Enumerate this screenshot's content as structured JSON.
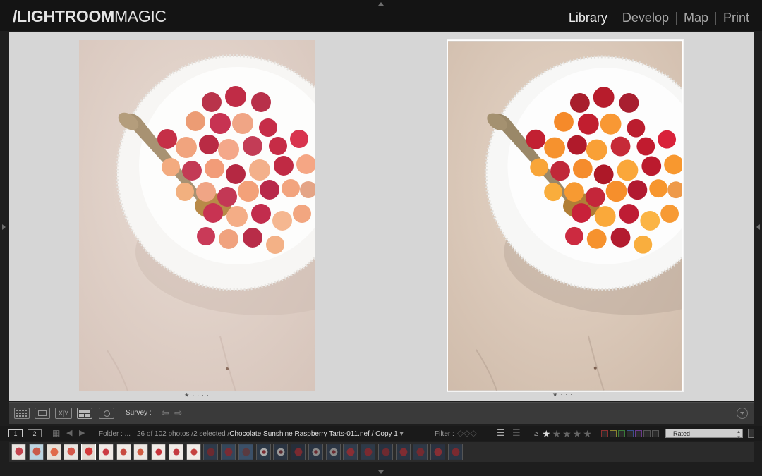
{
  "app": {
    "logo_bold": "/LIGHTROOM",
    "logo_light": "MAGIC"
  },
  "modules": [
    {
      "label": "Library",
      "active": true
    },
    {
      "label": "Develop",
      "active": false
    },
    {
      "label": "Map",
      "active": false
    },
    {
      "label": "Print",
      "active": false
    }
  ],
  "survey": {
    "left_rating_dots": "★ · · · ·",
    "right_rating_dots": "★ · · · ·"
  },
  "toolbar": {
    "survey_label": "Survey :",
    "view_icons": [
      "grid-view-icon",
      "loupe-view-icon",
      "compare-view-icon",
      "survey-view-icon",
      "people-view-icon"
    ],
    "compare_label": "X|Y"
  },
  "filmstrip_header": {
    "display1": "1",
    "display2": "2",
    "folder_label": "Folder : ...",
    "count_text": "26 of 102 photos /2 selected /",
    "filename": "Chocolate Sunshine Raspberry Tarts-011.nef / Copy 1",
    "filter_label": "Filter :",
    "rating_op": "≥",
    "rating_value": 1,
    "rating_max": 5,
    "filter_select": "Rated"
  },
  "filmstrip": {
    "thumb_count": 26,
    "selected_indices": [
      4,
      5
    ]
  },
  "colors": {
    "accent": "#e4e4e4",
    "background": "#1e1e1e",
    "survey_bg": "#d6d6d6",
    "photo_bg": "#e0d0c7",
    "raspberry_red": "#c22a3c",
    "golden_raspberry": "#f29a57"
  }
}
